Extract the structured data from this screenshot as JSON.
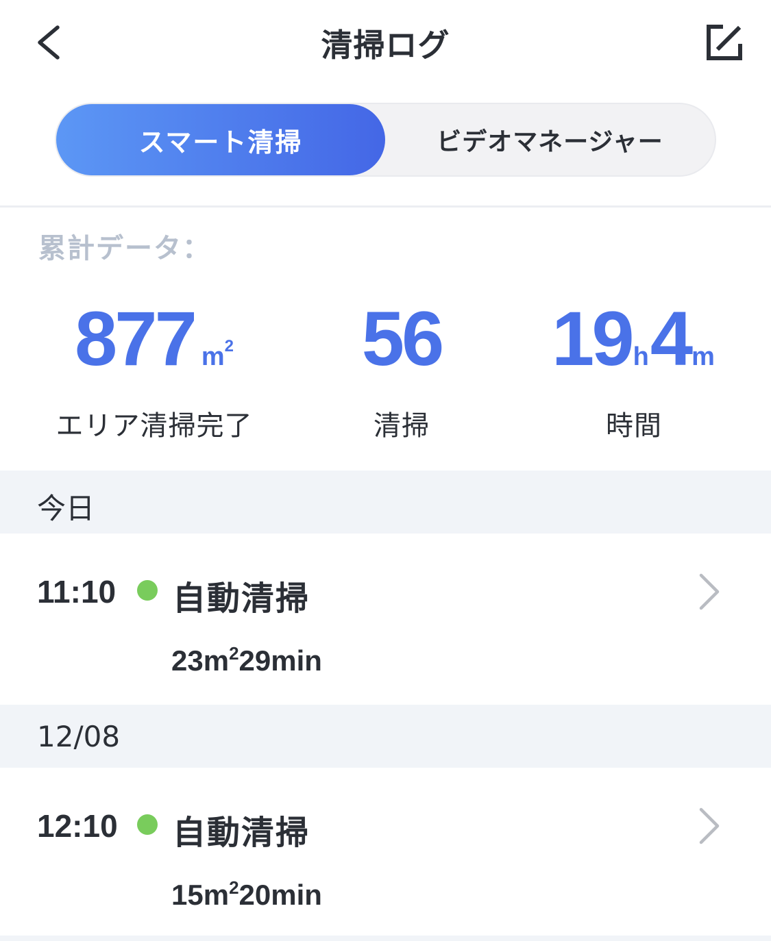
{
  "header": {
    "title": "清掃ログ",
    "back_icon": "chevron-left-icon",
    "edit_icon": "edit-export-icon"
  },
  "tabs": [
    {
      "label": "スマート清掃",
      "active": true
    },
    {
      "label": "ビデオマネージャー",
      "active": false
    }
  ],
  "summary": {
    "label": "累計データ：",
    "area": {
      "value": "877",
      "unit": "m",
      "unit_sup": "2",
      "label": "エリア清掃完了"
    },
    "count": {
      "value": "56",
      "label": "清掃"
    },
    "time": {
      "hours": "19",
      "hours_unit": "h",
      "minutes": "4",
      "minutes_unit": "m",
      "label": "時間"
    }
  },
  "sections": [
    {
      "date": "今日",
      "entries": [
        {
          "time": "11:10",
          "mode": "自動清掃",
          "area": "23",
          "area_unit": "m",
          "area_sup": "2",
          "duration": "29min",
          "status_color": "#79cc5c"
        }
      ]
    },
    {
      "date": "12/08",
      "entries": [
        {
          "time": "12:10",
          "mode": "自動清掃",
          "area": "15",
          "area_unit": "m",
          "area_sup": "2",
          "duration": "20min",
          "status_color": "#79cc5c"
        }
      ]
    }
  ],
  "colors": {
    "accent": "#4a72e8",
    "tab_gradient_start": "#5c97f5",
    "tab_gradient_end": "#4467e6",
    "status_ok": "#79cc5c",
    "section_bg": "#f1f4f8"
  }
}
